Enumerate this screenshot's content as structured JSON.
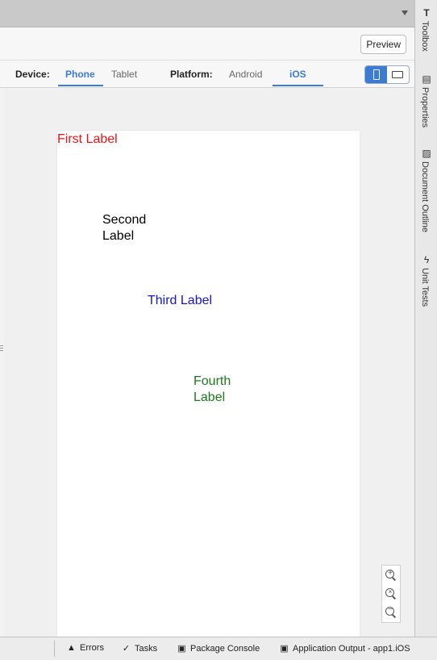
{
  "toolbar": {
    "preview_label": "Preview"
  },
  "designer_bar": {
    "device_label": "Device:",
    "device_tabs": [
      "Phone",
      "Tablet"
    ],
    "device_active": "Phone",
    "platform_label": "Platform:",
    "platform_tabs": [
      "Android",
      "iOS"
    ],
    "platform_active": "iOS",
    "orientation": "portrait",
    "accent_color": "#3a7bd5"
  },
  "device_labels": [
    {
      "text": "First Label",
      "color": "#ee1111"
    },
    {
      "text": "Second Label",
      "color": "#000000"
    },
    {
      "text": "Third Label",
      "color": "#1515cc"
    },
    {
      "text": "Fourth Label",
      "color": "#1c7a1c"
    }
  ],
  "zoom_controls": [
    "zoom-in-icon",
    "zoom-reset-icon",
    "zoom-out-icon"
  ],
  "right_panel": {
    "items": [
      "Toolbox",
      "Properties",
      "Document Outline",
      "Unit Tests"
    ]
  },
  "status_bar": {
    "items": [
      "Errors",
      "Tasks",
      "Package Console",
      "Application Output - app1.iOS"
    ]
  }
}
